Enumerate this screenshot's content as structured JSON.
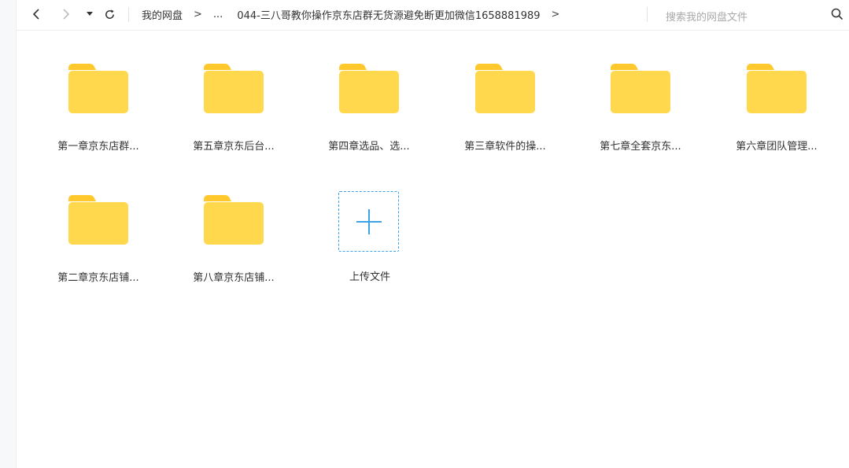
{
  "toolbar": {
    "breadcrumbs": {
      "root": "我的网盘",
      "ellipsis": "...",
      "current": "044-三八哥教你操作京东店群无货源避免断更加微信1658881989",
      "separator": ">"
    },
    "search": {
      "placeholder": "搜索我的网盘文件"
    }
  },
  "folders": [
    {
      "name": "第一章京东店群..."
    },
    {
      "name": "第五章京东后台..."
    },
    {
      "name": "第四章选品、选..."
    },
    {
      "name": "第三章软件的操..."
    },
    {
      "name": "第七章全套京东..."
    },
    {
      "name": "第六章团队管理..."
    },
    {
      "name": "第二章京东店铺..."
    },
    {
      "name": "第八章京东店铺..."
    }
  ],
  "upload": {
    "label": "上传文件"
  },
  "colors": {
    "folder_body": "#FFD84D",
    "folder_tab": "#FFC82C",
    "upload_accent": "#3BA3E8"
  }
}
